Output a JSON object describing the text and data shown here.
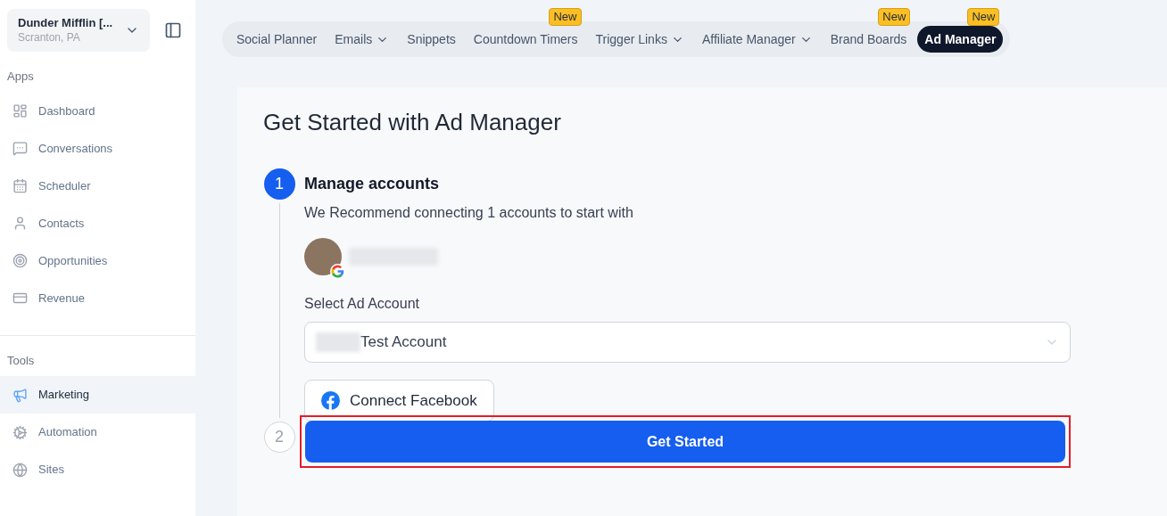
{
  "location": {
    "name": "Dunder Mifflin [...",
    "address": "Scranton, PA"
  },
  "sidebar": {
    "sections": [
      {
        "title": "Apps",
        "items": [
          {
            "label": "Dashboard",
            "selected": false
          },
          {
            "label": "Conversations",
            "selected": false
          },
          {
            "label": "Scheduler",
            "selected": false
          },
          {
            "label": "Contacts",
            "selected": false
          },
          {
            "label": "Opportunities",
            "selected": false
          },
          {
            "label": "Revenue",
            "selected": false
          }
        ]
      },
      {
        "title": "Tools",
        "items": [
          {
            "label": "Marketing",
            "selected": true
          },
          {
            "label": "Automation",
            "selected": false
          },
          {
            "label": "Sites",
            "selected": false
          }
        ]
      }
    ]
  },
  "tabs": [
    {
      "label": "Social Planner",
      "dropdown": false,
      "selected": false
    },
    {
      "label": "Emails",
      "dropdown": true,
      "selected": false
    },
    {
      "label": "Snippets",
      "dropdown": false,
      "selected": false
    },
    {
      "label": "Countdown Timers",
      "dropdown": false,
      "badge": "New",
      "selected": false
    },
    {
      "label": "Trigger Links",
      "dropdown": true,
      "selected": false
    },
    {
      "label": "Affiliate Manager",
      "dropdown": true,
      "selected": false
    },
    {
      "label": "Brand Boards",
      "dropdown": false,
      "badge": "New",
      "selected": false
    },
    {
      "label": "Ad Manager",
      "dropdown": false,
      "badge": "New",
      "selected": true
    }
  ],
  "page_title": "Get Started with Ad Manager",
  "steps": [
    {
      "number": "1",
      "selected": true,
      "title": "Manage accounts",
      "description": "We Recommend connecting 1 accounts to start with",
      "field_label": "Select Ad Account",
      "field_value": "Test Account",
      "connect_button": "Connect Facebook"
    },
    {
      "number": "2",
      "selected": false,
      "button": "Get Started",
      "highlighted": true
    }
  ]
}
